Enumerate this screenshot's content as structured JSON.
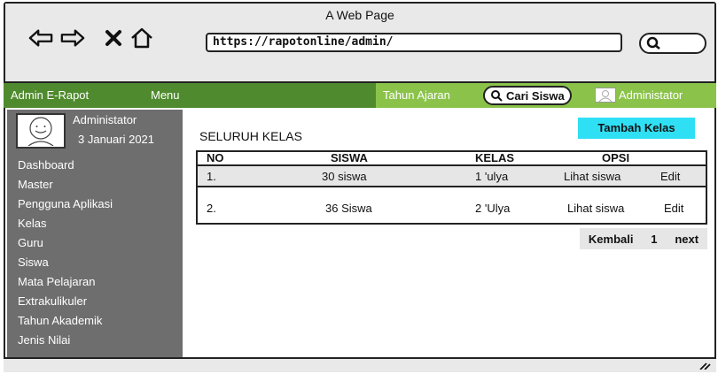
{
  "browser": {
    "page_title": "A Web Page",
    "url": "https://rapotonline/admin/"
  },
  "header": {
    "brand": "Admin E-Rapot",
    "menu": "Menu",
    "tahun_ajaran": "Tahun Ajaran",
    "search_button": "Cari Siswa",
    "user": "Administator"
  },
  "sidebar": {
    "profile_name": "Administator",
    "profile_date": "3 Januari 2021",
    "items": [
      {
        "label": "Dashboard"
      },
      {
        "label": "Master"
      },
      {
        "label": "Pengguna Aplikasi"
      },
      {
        "label": "Kelas"
      },
      {
        "label": "Guru"
      },
      {
        "label": "Siswa"
      },
      {
        "label": "Mata Pelajaran"
      },
      {
        "label": "Extrakulikuler"
      },
      {
        "label": "Tahun Akademik"
      },
      {
        "label": "Jenis Nilai"
      }
    ]
  },
  "main": {
    "title": "SELURUH KELAS",
    "add_button": "Tambah Kelas",
    "table": {
      "headers": {
        "no": "NO",
        "siswa": "SISWA",
        "kelas": "KELAS",
        "opsi": "OPSI"
      },
      "rows": [
        {
          "no": "1.",
          "siswa": "30 siswa",
          "kelas": "1 'ulya",
          "view": "Lihat siswa",
          "edit": "Edit"
        },
        {
          "no": "2.",
          "siswa": "36 Siswa",
          "kelas": "2 'Ulya",
          "view": "Lihat siswa",
          "edit": "Edit"
        }
      ]
    },
    "pager": {
      "back": "Kembali",
      "page": "1",
      "next": "next"
    }
  },
  "colors": {
    "header_dark_green": "#4f8b2e",
    "header_light_green": "#8bc34a",
    "sidebar": "#6e6e6e",
    "add_button": "#2fe0f5"
  }
}
